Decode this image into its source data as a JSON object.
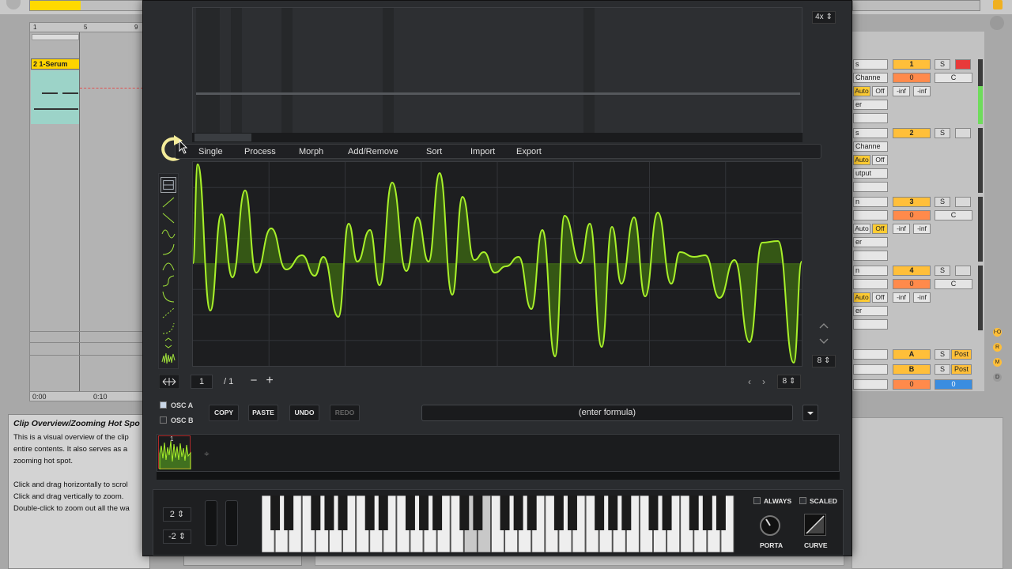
{
  "daw": {
    "ruler_marks": [
      "1",
      "5",
      "9"
    ],
    "clip_title": "2 1-Serum",
    "time_labels": [
      "0:00",
      "0:10"
    ],
    "info": {
      "title": "Clip Overview/Zooming Hot Spo",
      "lines": [
        "This is a visual overview of the clip",
        "entire contents. It also serves as a",
        "zooming hot spot.",
        "",
        "Click and drag horizontally to scrol",
        "Click and drag vertically to zoom.",
        "Double-click to zoom out all the wa"
      ]
    },
    "mixer": {
      "tracks": [
        {
          "number": "1",
          "solo": "S",
          "vol": "0",
          "pan": "C",
          "auto": "Auto",
          "off": "Off",
          "inf1": "-inf",
          "inf2": "-inf",
          "sel1": "s",
          "sel2": "Channe",
          "sel3": "er"
        },
        {
          "number": "2",
          "solo": "S",
          "vol": "",
          "pan": "",
          "auto": "Auto",
          "off": "Off",
          "inf1": "",
          "inf2": "",
          "sel1": "s",
          "sel2": "Channe",
          "sel3": "utput"
        },
        {
          "number": "3",
          "solo": "S",
          "vol": "0",
          "pan": "C",
          "auto": "Auto",
          "off": "Off",
          "inf1": "-inf",
          "inf2": "-inf",
          "sel1": "n",
          "sel2": "",
          "sel3": "er"
        },
        {
          "number": "4",
          "solo": "S",
          "vol": "0",
          "pan": "C",
          "auto": "Auto",
          "off": "Off",
          "inf1": "-inf",
          "inf2": "-inf",
          "sel1": "n",
          "sel2": "",
          "sel3": "er"
        }
      ],
      "returns": [
        {
          "name": "A",
          "solo": "S",
          "post": "Post"
        },
        {
          "name": "B",
          "solo": "S",
          "post": "Post"
        }
      ],
      "master_vol": "0",
      "master_pan": "0"
    },
    "side_buttons": [
      "I-O",
      "R",
      "M",
      "D"
    ]
  },
  "serum": {
    "zoom": "4x",
    "menu": [
      "Single",
      "Process",
      "Morph",
      "Add/Remove",
      "Sort",
      "Import",
      "Export"
    ],
    "grid_size": "8",
    "frame_current": "1",
    "frame_total": "/ 1",
    "minus": "−",
    "plus": "+",
    "nav_prev": "‹",
    "nav_next": "›",
    "grid_size_2": "8",
    "osc_a": "OSC A",
    "osc_b": "OSC B",
    "buttons": {
      "copy": "COPY",
      "paste": "PASTE",
      "undo": "UNDO",
      "redo": "REDO"
    },
    "formula_placeholder": "(enter formula)",
    "pitch_up": "2",
    "pitch_down": "-2",
    "always": "ALWAYS",
    "scaled": "SCALED",
    "porta": "PORTA",
    "curve": "CURVE",
    "colors": {
      "wave": "#a8f02a",
      "fill": "#3d6b12",
      "bg": "#2a2c2f"
    },
    "thumb_marker": "1"
  }
}
